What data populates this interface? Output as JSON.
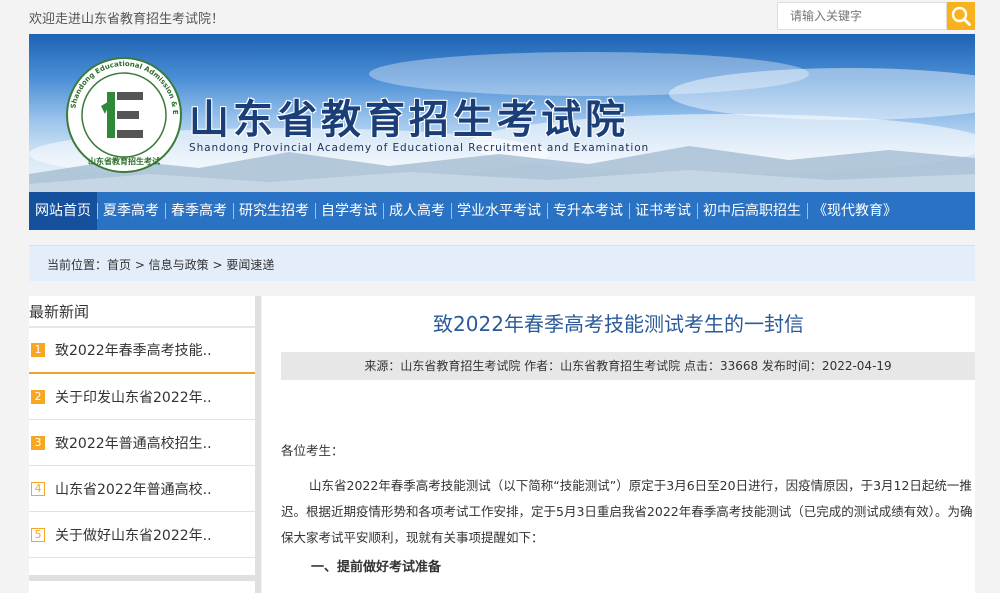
{
  "topbar": {
    "welcome": "欢迎走进山东省教育招生考试院！",
    "search_placeholder": "请输入关键字"
  },
  "banner": {
    "title": "山东省教育招生考试院",
    "subtitle": "Shandong Provincial Academy of Educational Recruitment and Examination",
    "logo_ring_text": "Shandong Educational Admission & Examination",
    "logo_bottom_text": "山东省教育招生考试"
  },
  "nav": {
    "items": [
      "网站首页",
      "夏季高考",
      "春季高考",
      "研究生招考",
      "自学考试",
      "成人高考",
      "学业水平考试",
      "专升本考试",
      "证书考试",
      "初中后高职招生",
      "《现代教育》"
    ]
  },
  "breadcrumb": "当前位置：首页 > 信息与政策 > 要闻速递",
  "sidebar": {
    "heading": "最新新闻",
    "items": [
      {
        "num": "1",
        "label": "致2022年春季高考技能.."
      },
      {
        "num": "2",
        "label": "关于印发山东省2022年.."
      },
      {
        "num": "3",
        "label": "致2022年普通高校招生.."
      },
      {
        "num": "4",
        "label": "山东省2022年普通高校.."
      },
      {
        "num": "5",
        "label": "关于做好山东省2022年.."
      }
    ]
  },
  "article": {
    "title": "致2022年春季高考技能测试考生的一封信",
    "meta": "来源：山东省教育招生考试院 作者：山东省教育招生考试院 点击：33668 发布时间：2022-04-19",
    "greeting": "各位考生：",
    "paragraph1": "山东省2022年春季高考技能测试（以下简称“技能测试”）原定于3月6日至20日进行，因疫情原因，于3月12日起统一推迟。根据近期疫情形势和各项考试工作安排，定于5月3日重启我省2022年春季高考技能测试（已完成的测试成绩有效）。为确保大家考试平安顺利，现就有关事项提醒如下：",
    "section1": "一、提前做好考试准备"
  },
  "colors": {
    "nav_bg": "#2a72c4",
    "nav_active": "#15509d",
    "accent_orange": "#f6a623",
    "title_blue": "#2b5a99"
  }
}
